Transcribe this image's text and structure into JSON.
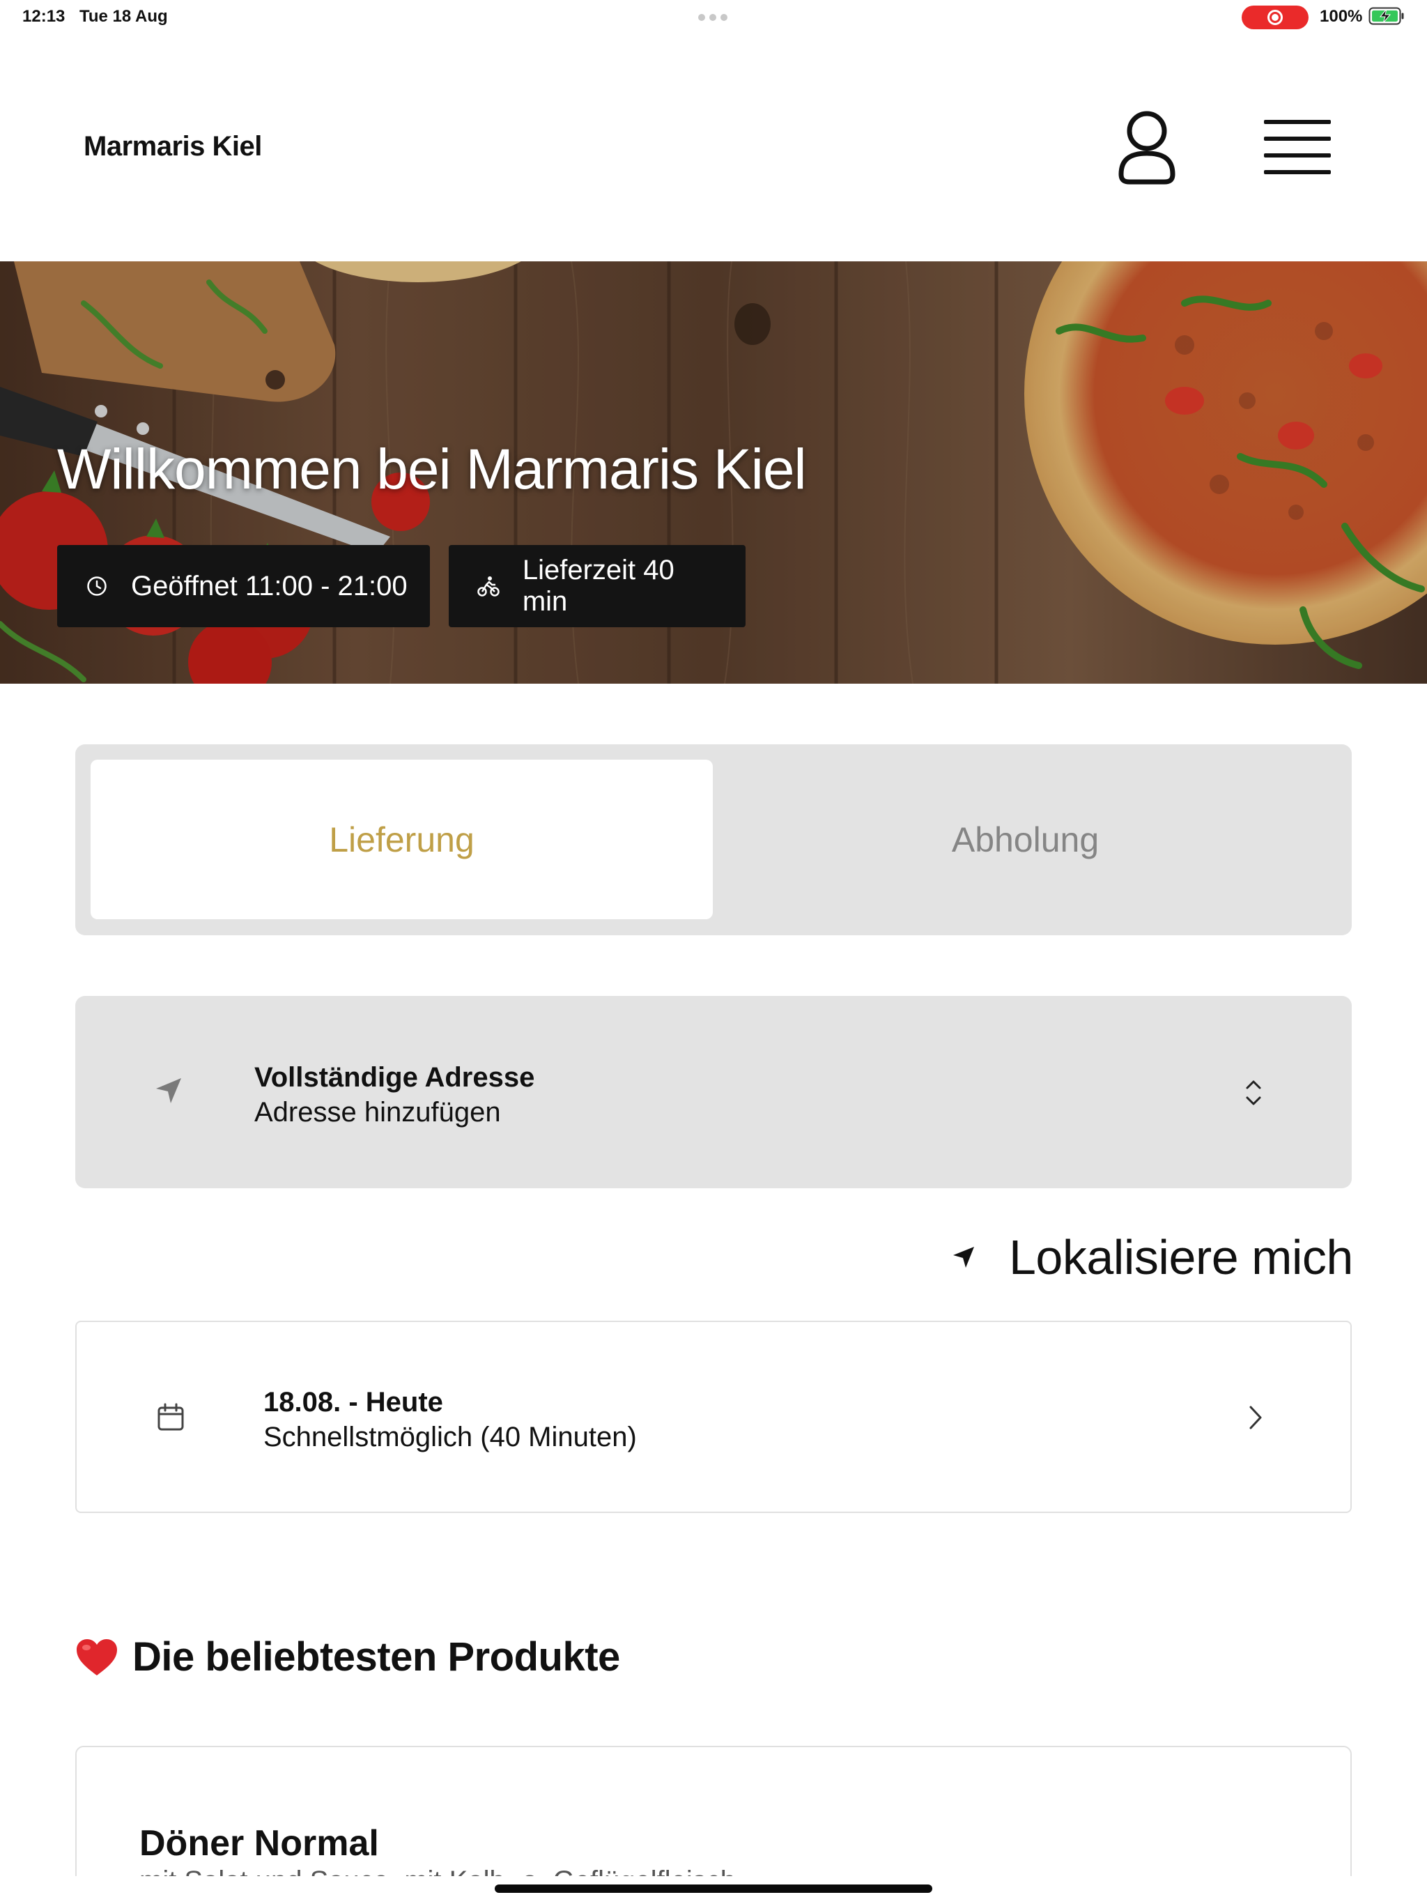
{
  "status_bar": {
    "time": "12:13",
    "date": "Tue 18 Aug",
    "battery": "100%",
    "icons": [
      "screen-recording-icon",
      "battery-charging-icon"
    ]
  },
  "header": {
    "brand": "Marmaris Kiel",
    "icons": [
      "account-icon",
      "hamburger-menu-icon"
    ]
  },
  "hero": {
    "title": "Willkommen bei Marmaris Kiel",
    "opening_hours": "Geöffnet 11:00 - 21:00",
    "delivery_time": "Lieferzeit 40 min",
    "icons": [
      "clock-icon",
      "cyclist-icon"
    ]
  },
  "order_mode": {
    "options": [
      "Lieferung",
      "Abholung"
    ],
    "selected": "Lieferung",
    "accent_color": "#bf9f47"
  },
  "address": {
    "title": "Vollständige Adresse",
    "placeholder": "Adresse hinzufügen",
    "icons": [
      "location-arrow-icon",
      "chevron-up-down-icon"
    ]
  },
  "locate": {
    "label": "Lokalisiere mich"
  },
  "schedule": {
    "title": "18.08. - Heute",
    "subtitle": "Schnellstmöglich (40 Minuten)",
    "icons": [
      "calendar-icon",
      "chevron-right-icon"
    ]
  },
  "popular": {
    "title": "Die beliebtesten Produkte",
    "products": [
      {
        "name": "Döner Normal",
        "description": "mit Salat und Sauce, mit Kalb- o. Geflügelfleisch"
      }
    ]
  }
}
